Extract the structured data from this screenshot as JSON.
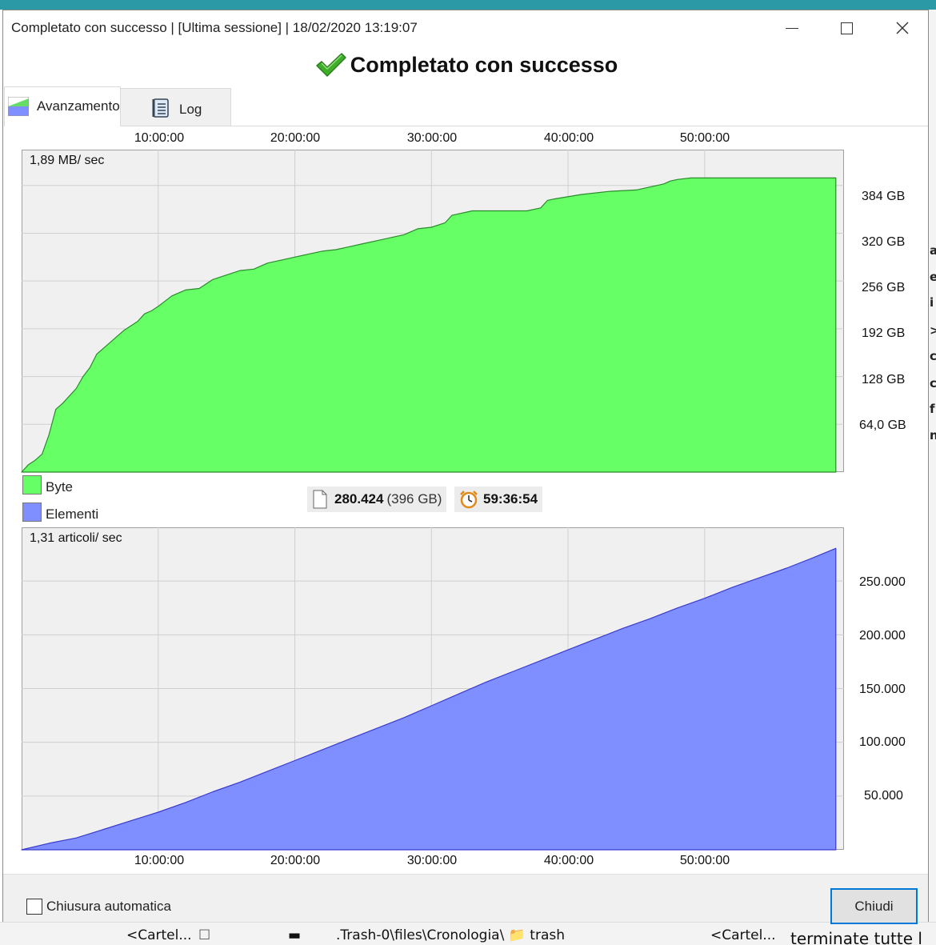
{
  "window": {
    "title": "Completato con successo | [Ultima sessione] | 18/02/2020 13:19:07",
    "heading": "Completato con successo"
  },
  "tabs": [
    {
      "label": "Avanzamento",
      "icon": "chart-icon",
      "active": true
    },
    {
      "label": "Log",
      "icon": "log-icon",
      "active": false
    }
  ],
  "x_axis_ticks": [
    "10:00:00",
    "20:00:00",
    "30:00:00",
    "40:00:00",
    "50:00:00"
  ],
  "legend": [
    {
      "label": "Byte",
      "color": "#66ff66"
    },
    {
      "label": "Elementi",
      "color": "#7f8fff"
    }
  ],
  "summary": {
    "items_count": "280.424",
    "items_size": "(396 GB)",
    "duration": "59:36:54"
  },
  "chart_data": [
    {
      "type": "area",
      "rate_label": "1,89 MB/ sec",
      "color": "#66ff66",
      "edge_color": "#2a8a2a",
      "y_ticks": [
        "384 GB",
        "320 GB",
        "256 GB",
        "192 GB",
        "128 GB",
        "64,0 GB"
      ],
      "x_unit": "hours",
      "y_unit": "GB",
      "xlim": [
        0,
        60.2
      ],
      "ylim": [
        0,
        432
      ],
      "series": [
        {
          "name": "Byte",
          "x": [
            0,
            0.5,
            1,
            1.5,
            2,
            2.5,
            3,
            3.5,
            4,
            4.5,
            5,
            5.5,
            6,
            6.5,
            7,
            7.5,
            8,
            8.5,
            9,
            9.5,
            10,
            11,
            12,
            13,
            14,
            15,
            16,
            17,
            18,
            19,
            20,
            21,
            22,
            23,
            24,
            25,
            26,
            27,
            28,
            29,
            30,
            31,
            31.5,
            33,
            35,
            37,
            38,
            38.5,
            39,
            41,
            43,
            45,
            47,
            47.5,
            48,
            49,
            50,
            52,
            55,
            58,
            59.6
          ],
          "y": [
            0,
            10,
            16,
            24,
            50,
            84,
            92,
            102,
            112,
            128,
            140,
            158,
            166,
            174,
            182,
            190,
            196,
            202,
            212,
            216,
            222,
            236,
            244,
            246,
            258,
            264,
            270,
            272,
            280,
            284,
            288,
            292,
            296,
            298,
            302,
            306,
            310,
            314,
            318,
            326,
            328,
            334,
            344,
            350,
            350,
            350,
            354,
            364,
            366,
            372,
            376,
            378,
            386,
            390,
            392,
            394,
            394,
            394,
            394,
            394,
            394
          ]
        }
      ]
    },
    {
      "type": "area",
      "rate_label": "1,31 articoli/ sec",
      "color": "#7f8fff",
      "edge_color": "#3a3ad0",
      "y_ticks": [
        "250.000",
        "200.000",
        "150.000",
        "100.000",
        "50.000"
      ],
      "x_unit": "hours",
      "y_unit": "items",
      "xlim": [
        0,
        60.2
      ],
      "ylim": [
        0,
        300000
      ],
      "series": [
        {
          "name": "Elementi",
          "x": [
            0,
            2,
            4,
            6,
            8,
            10,
            12,
            14,
            16,
            18,
            20,
            22,
            24,
            26,
            28,
            30,
            32,
            34,
            36,
            38,
            40,
            42,
            44,
            46,
            48,
            50,
            52,
            54,
            56,
            58,
            59.6
          ],
          "y": [
            0,
            6000,
            11000,
            19000,
            27000,
            35000,
            44000,
            54000,
            63000,
            73000,
            83000,
            93000,
            103000,
            113000,
            123000,
            134000,
            145000,
            156000,
            166000,
            176000,
            186000,
            196000,
            206000,
            215000,
            225000,
            234000,
            244000,
            253000,
            262000,
            272000,
            280424
          ]
        }
      ]
    }
  ],
  "footer": {
    "auto_close_label": "Chiusura automatica",
    "close_label": "Chiudi"
  }
}
